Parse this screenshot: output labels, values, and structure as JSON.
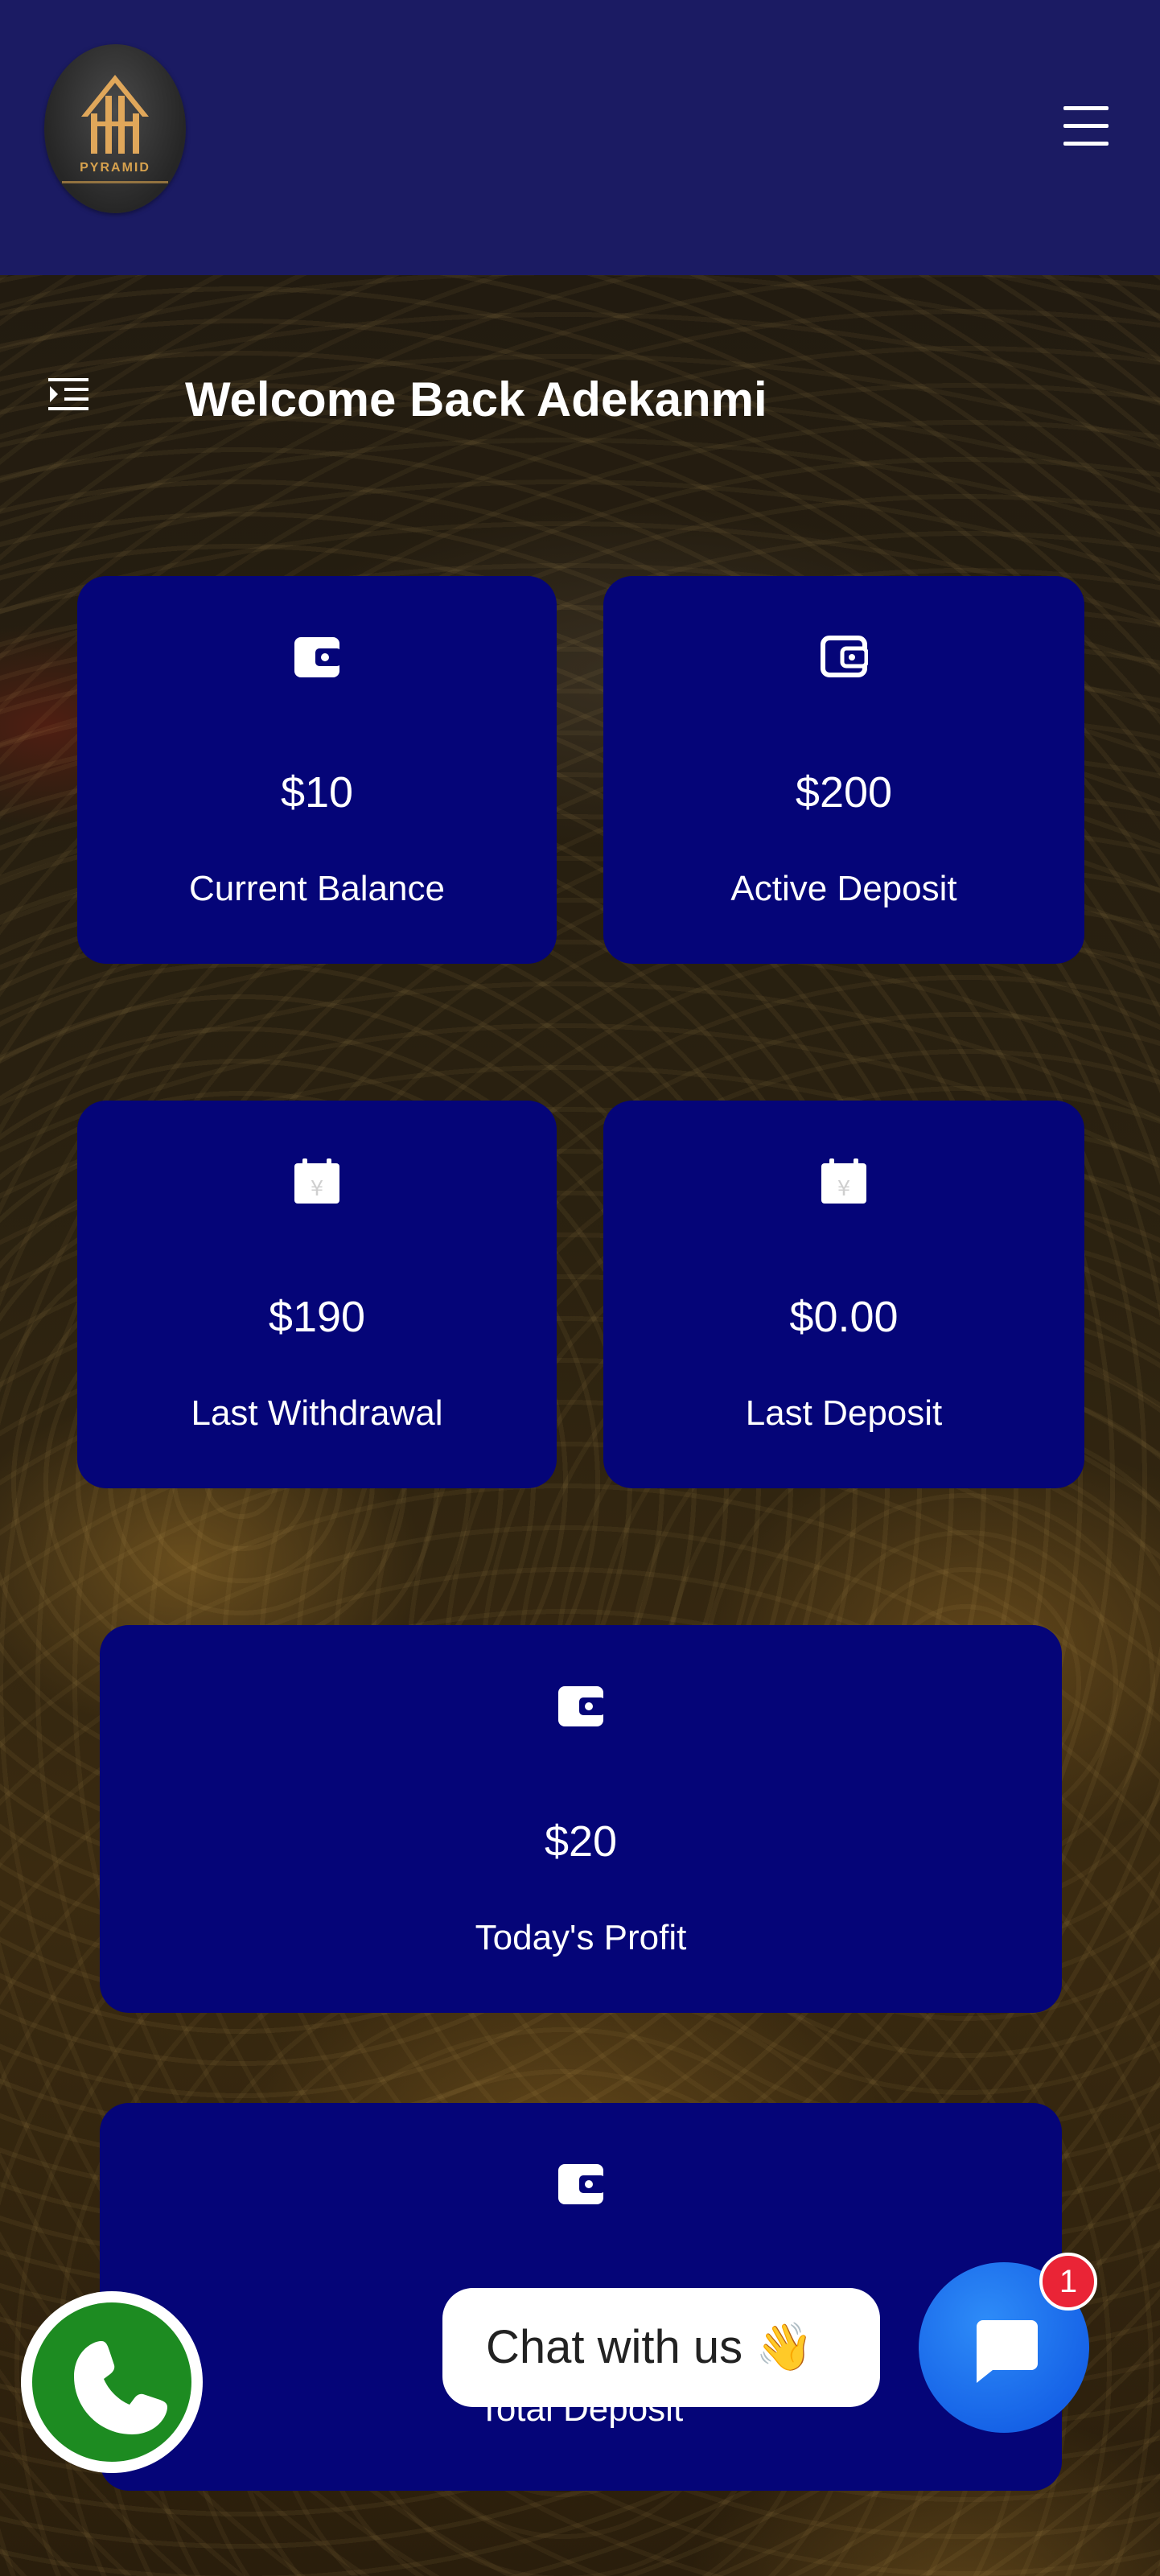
{
  "header": {
    "logo_text": "PYRAMID",
    "menu_icon": "hamburger-icon"
  },
  "welcome": {
    "sidebar_toggle_icon": "indent-menu-icon",
    "title": "Welcome Back Adekanmi"
  },
  "cards": [
    {
      "icon": "wallet-icon",
      "value": "$10",
      "label": "Current Balance"
    },
    {
      "icon": "wallet-icon",
      "value": "$200",
      "label": "Active Deposit"
    },
    {
      "icon": "calendar-icon",
      "value": "$190",
      "label": "Last Withdrawal"
    },
    {
      "icon": "calendar-icon",
      "value": "$0.00",
      "label": "Last Deposit"
    },
    {
      "icon": "wallet-icon",
      "value": "$20",
      "label": "Today's Profit"
    },
    {
      "icon": "wallet-icon",
      "value": "",
      "label": "Total Deposit"
    }
  ],
  "floating": {
    "whatsapp_icon": "whatsapp-icon",
    "chat_text": "Chat with us",
    "chat_emoji": "👋",
    "chat_icon": "chat-icon",
    "unread_count": "1"
  },
  "colors": {
    "header_bg": "#1b1b63",
    "card_bg": "#050578",
    "whatsapp": "#1d8b21",
    "chat_button": "#1a6ff0",
    "badge": "#ea2436"
  }
}
